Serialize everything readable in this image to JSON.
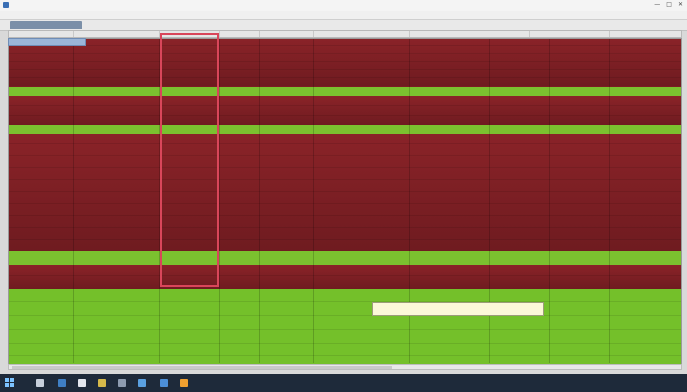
{
  "window": {
    "title": "",
    "controls": [
      "—",
      "□",
      "✕"
    ]
  },
  "menubar": {
    "items": [
      "",
      "",
      "",
      "",
      "",
      "",
      "",
      ""
    ]
  },
  "toolbar": {
    "active_tab": ""
  },
  "grid": {
    "filter_label": "",
    "columns": [
      "",
      "",
      "",
      "",
      "",
      "",
      "",
      "",
      "",
      ""
    ]
  },
  "tooltip": {
    "line1": "",
    "line2": ""
  },
  "taskbar": {
    "tray_text": "",
    "clock": ""
  },
  "colors": {
    "red_row": "#7b1d22",
    "green_row": "#7bc12f",
    "highlight_border": "#d9465a",
    "taskbar": "#1e2a3a"
  }
}
